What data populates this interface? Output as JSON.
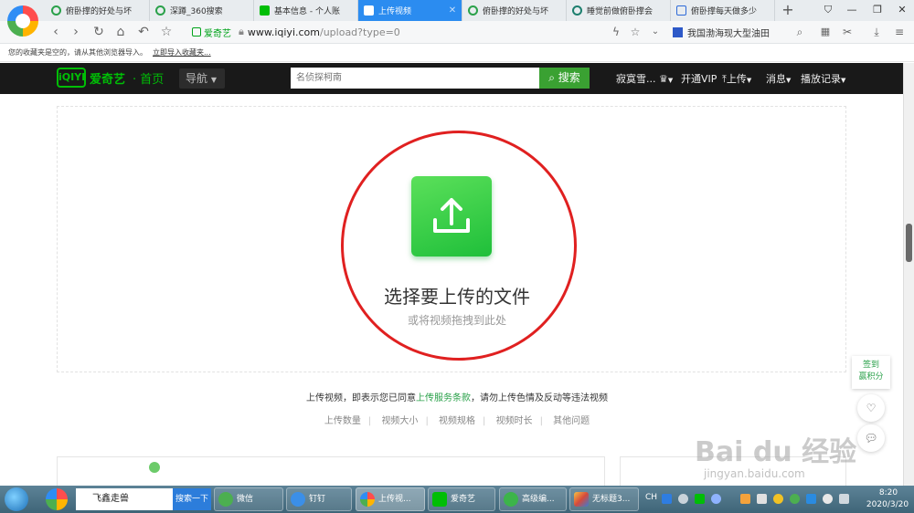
{
  "browser": {
    "tabs": [
      {
        "label": "俯卧撑的好处与坏",
        "active": false
      },
      {
        "label": "深蹲_360搜索",
        "active": false
      },
      {
        "label": "基本信息 - 个人账",
        "active": false
      },
      {
        "label": "上传视频",
        "active": true
      },
      {
        "label": "俯卧撑的好处与坏",
        "active": false
      },
      {
        "label": "睡觉前做俯卧撑会",
        "active": false
      },
      {
        "label": "俯卧撑每天做多少",
        "active": false
      }
    ],
    "new_tab_glyph": "+",
    "url_site_badge": "爱奇艺",
    "url_host": "www.iqiyi.com",
    "url_path": "/upload?type=0",
    "quick_search_text": "我国渤海现大型油田",
    "bookmark_bar_text": "您的收藏夹是空的，请从其他浏览器导入。",
    "bookmark_bar_link": "立即导入收藏夹..."
  },
  "header": {
    "logo_text": "iQIYI",
    "brand": "爱奇艺",
    "home": "· 首页",
    "nav": "导航",
    "search_placeholder": "名侦探柯南",
    "search_button": "搜索",
    "user_name": "寂寞雪...",
    "vip": "开通VIP",
    "upload": "上传",
    "messages": "消息",
    "history": "播放记录"
  },
  "upload": {
    "title": "选择要上传的文件",
    "subtitle": "或将视频拖拽到此处",
    "agreement_prefix": "上传视频，即表示您已同意",
    "agreement_link": "上传服务条款",
    "agreement_suffix": "，请勿上传色情及反动等违法视频",
    "info_links": [
      "上传数量",
      "视频大小",
      "视频规格",
      "视频时长",
      "其他问题"
    ]
  },
  "float": {
    "sign_in_line1": "签到",
    "sign_in_line2": "赢积分"
  },
  "watermark": {
    "main": "Bai du 经验",
    "sub": "jingyan.baidu.com"
  },
  "taskbar": {
    "search_text": "飞鑫走兽",
    "search_button": "搜索一下",
    "apps": [
      {
        "label": "微信",
        "active": false
      },
      {
        "label": "钉钉",
        "active": false
      },
      {
        "label": "上传视...",
        "active": true
      },
      {
        "label": "爱奇艺",
        "active": false
      },
      {
        "label": "高级编...",
        "active": false
      },
      {
        "label": "无标题3...",
        "active": false
      }
    ],
    "ime": "CH",
    "time": "8:20",
    "date": "2020/3/20"
  },
  "colors": {
    "accent_green": "#2aa14a",
    "header_bg": "#191919",
    "active_tab": "#2b8cf0",
    "annotation_red": "#e02020"
  }
}
